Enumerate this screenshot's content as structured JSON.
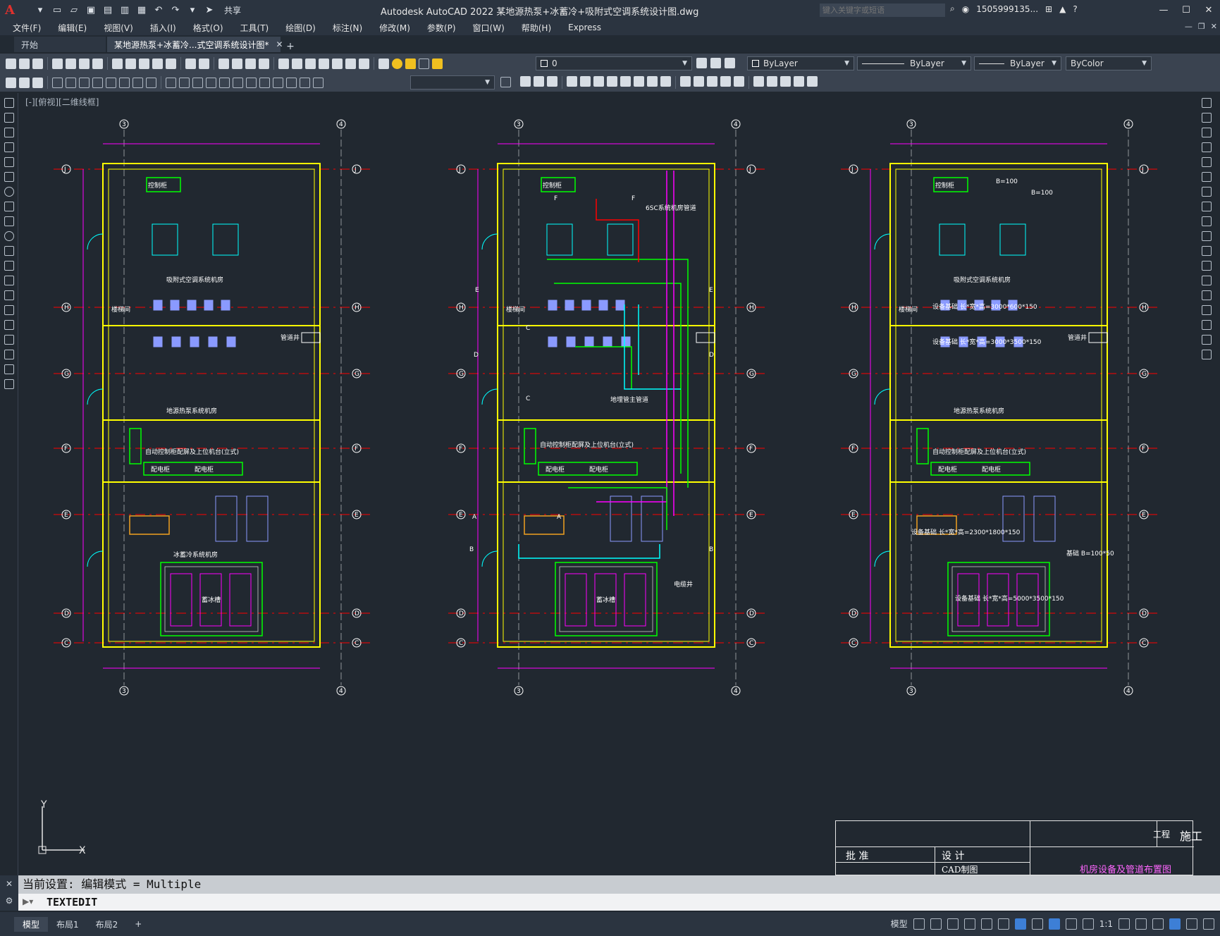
{
  "app": {
    "title": "Autodesk AutoCAD 2022    某地源热泵+冰蓄冷+吸附式空调系统设计图.dwg",
    "logo_letter": "A",
    "share_label": "共享",
    "search_placeholder": "键入关键字或短语",
    "user": "1505999135...",
    "accent_color": "#e0312d"
  },
  "menu": {
    "items": [
      "文件(F)",
      "编辑(E)",
      "视图(V)",
      "插入(I)",
      "格式(O)",
      "工具(T)",
      "绘图(D)",
      "标注(N)",
      "修改(M)",
      "参数(P)",
      "窗口(W)",
      "帮助(H)",
      "Express"
    ]
  },
  "tabs": {
    "start": "开始",
    "active": "某地源热泵+冰蓄冷...式空调系统设计图*",
    "close": "✕",
    "add": "+"
  },
  "properties": {
    "layer": "0",
    "color": "ByLayer",
    "linetype": "ByLayer",
    "lineweight": "ByLayer",
    "plotstyle": "ByColor"
  },
  "viewport": {
    "label": "[-][俯视][二维线框]"
  },
  "drawing": {
    "grid_row_labels": [
      "J",
      "H",
      "G",
      "F",
      "E",
      "D",
      "C"
    ],
    "grid_col_labels": [
      "3",
      "4"
    ],
    "plan1": {
      "rooms": [
        "控制柜",
        "吸附式空调系统机房",
        "地源热泵系统机房",
        "自动控制柜配屏及上位机台(立式)",
        "冰蓄冷系统机房",
        "蓄冰槽",
        "配电柜",
        "配电柜",
        "管道井",
        "楼梯间"
      ]
    },
    "plan2": {
      "rooms": [
        "控制柜",
        "自动控制柜配屏及上位机台(立式)",
        "地埋管主管道",
        "蓄冰槽",
        "配电柜",
        "配电柜",
        "电缆井",
        "楼梯间"
      ],
      "section_marks": [
        "F",
        "F",
        "E",
        "E",
        "D",
        "D",
        "C",
        "C",
        "A",
        "A",
        "B",
        "B"
      ],
      "note": "6SC系统机房管道"
    },
    "plan3": {
      "rooms": [
        "控制柜",
        "吸附式空调系统机房",
        "地源热泵系统机房",
        "自动控制柜配屏及上位机台(立式)",
        "配电柜",
        "配电柜",
        "管道井",
        "楼梯间"
      ],
      "notes": [
        "B=100",
        "B=100",
        "设备基础 长*宽*高=3000*600*150",
        "设备基础 长*宽*高=3000*3500*150",
        "设备基础 长*宽*高=2300*1800*150",
        "设备基础 长*宽*高=5000*3500*150",
        "基础 B=100*50"
      ]
    }
  },
  "ucs": {
    "y": "Y",
    "x": "X"
  },
  "titleblock": {
    "project": "工程",
    "stage": "施工",
    "approve": "批 准",
    "design": "设 计",
    "draw": "CAD制图",
    "sheet_title": "机房设备及管道布置图"
  },
  "command": {
    "history": "当前设置: 编辑模式 = Multiple",
    "input": "TEXTEDIT"
  },
  "status": {
    "layouts": [
      "模型",
      "布局1",
      "布局2"
    ],
    "add": "+",
    "model_label": "模型",
    "scale": "1:1"
  },
  "colors": {
    "wall": "#ffff00",
    "dimension": "#ff00ff",
    "grid_line": "#ff0000",
    "pipe_green": "#00ff00",
    "pipe_cyan": "#00ffff",
    "equipment": "#00ff00"
  }
}
